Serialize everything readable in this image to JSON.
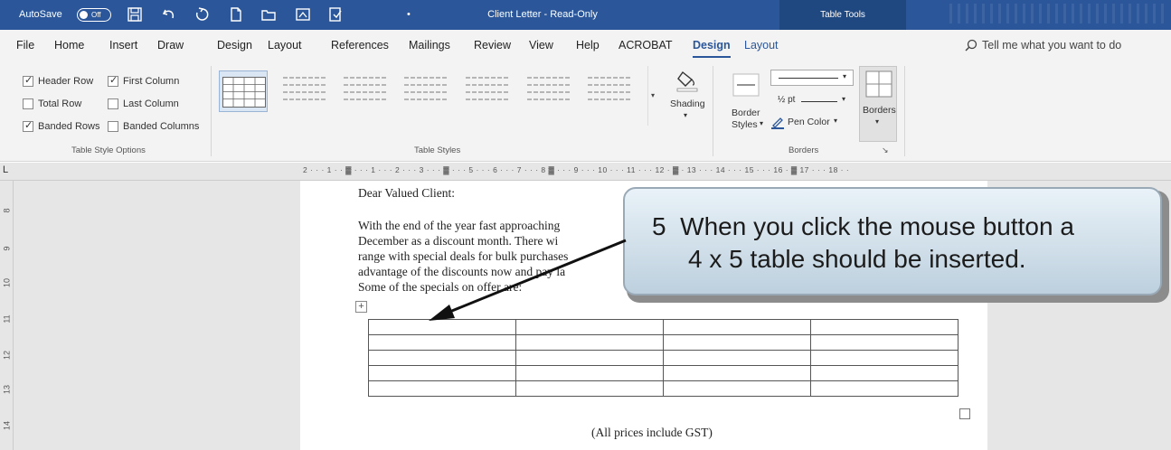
{
  "titlebar": {
    "autosave_label": "AutoSave",
    "autosave_state": "Off",
    "doc_title": "Client Letter  -  Read-Only",
    "context_label": "Table Tools",
    "separator": "•"
  },
  "menu": {
    "tabs": [
      {
        "label": "File"
      },
      {
        "label": "Home"
      },
      {
        "label": "Insert"
      },
      {
        "label": "Draw"
      },
      {
        "label": "Design"
      },
      {
        "label": "Layout"
      },
      {
        "label": "References"
      },
      {
        "label": "Mailings"
      },
      {
        "label": "Review"
      },
      {
        "label": "View"
      },
      {
        "label": "Help"
      },
      {
        "label": "ACROBAT"
      },
      {
        "label": "Design"
      },
      {
        "label": "Layout"
      }
    ],
    "active_tab": "Design",
    "tell_me": "Tell me what you want to do"
  },
  "ribbon": {
    "options": {
      "header_row": {
        "label": "Header Row",
        "checked": true
      },
      "first_column": {
        "label": "First Column",
        "checked": true
      },
      "total_row": {
        "label": "Total Row",
        "checked": false
      },
      "last_column": {
        "label": "Last Column",
        "checked": false
      },
      "banded_rows": {
        "label": "Banded Rows",
        "checked": true
      },
      "banded_columns": {
        "label": "Banded Columns",
        "checked": false
      },
      "group_label": "Table Style Options"
    },
    "table_styles": {
      "group_label": "Table Styles"
    },
    "shading_label": "Shading",
    "borders": {
      "border_styles_line1": "Border",
      "border_styles_line2": "Styles",
      "pen_weight": "½ pt",
      "pen_color": "Pen Color",
      "borders_label": "Borders",
      "group_label": "Borders"
    }
  },
  "ruler": {
    "horizontal": "2 · · · 1 · · ▓ · · · 1 · · · 2 · · · 3 · · · ▓ · · · 5 · · · 6 · · · 7 · · · 8 ▓ · · · 9 · · · 10 · · · 11 · · · 12 · ▓ · 13 · · · 14 · · · 15 · · · 16 · ▓ 17 · · · 18 · ·",
    "vertical": [
      "8",
      "9",
      "10",
      "11",
      "12",
      "13",
      "14"
    ]
  },
  "document": {
    "salutation": "Dear Valued Client:",
    "body_lines": [
      "With the end of the year fast approaching",
      "December as a discount month.  There wi",
      "range with special deals for bulk purchases",
      "advantage of the discounts now and pay la",
      "Some of the specials on offer are:"
    ],
    "table": {
      "rows": 5,
      "cols": 4
    },
    "footer_note": "(All prices include GST)"
  },
  "callout": {
    "step_number": "5",
    "line1": "When you click the mouse button a",
    "line2": "4 x 5 table should be inserted."
  }
}
